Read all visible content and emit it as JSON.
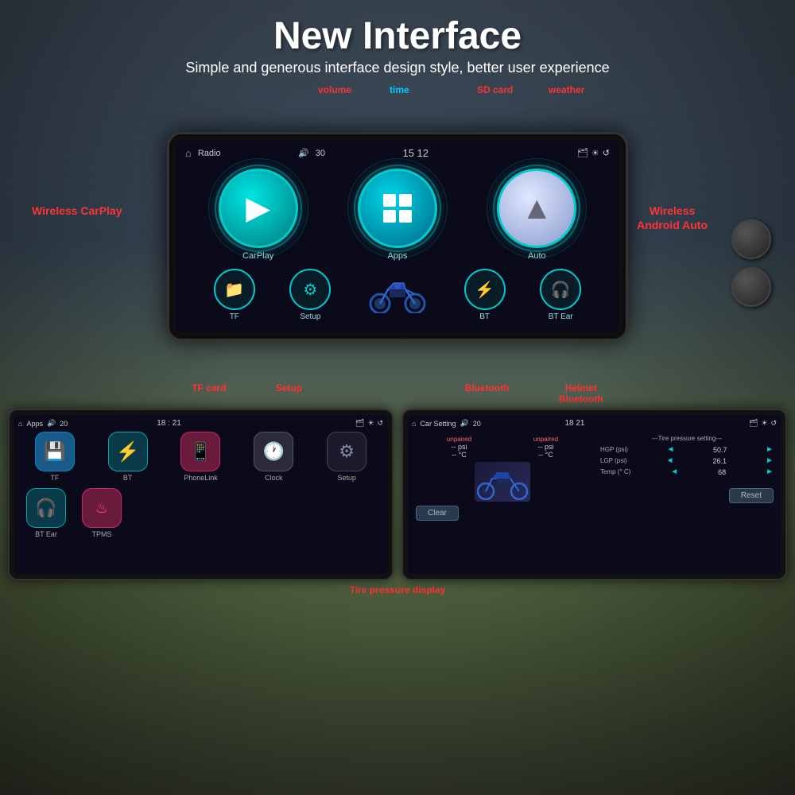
{
  "header": {
    "title": "New Interface",
    "subtitle": "Simple and generous interface design style, better user experience"
  },
  "labels": {
    "volume": "volume",
    "time": "time",
    "sd_card": "SD card",
    "weather": "weather",
    "wireless_carplay": "Wireless\nCarPlay",
    "wireless_android": "Wireless\nAndroid Auto",
    "tf_card": "TF card",
    "setup": "Setup",
    "bluetooth": "Bluetooth",
    "helmet_bluetooth": "Helmet\nBluetooth",
    "tire_pressure_display": "Tire pressure\ndisplay"
  },
  "main_screen": {
    "status": {
      "home_icon": "⌂",
      "radio": "Radio",
      "volume_icon": "🔊",
      "volume": "30",
      "time": "15 12",
      "sd_icon": "📱",
      "brightness_icon": "☀",
      "back_icon": "↺"
    },
    "big_buttons": [
      {
        "label": "CarPlay",
        "icon": "▶"
      },
      {
        "label": "Apps",
        "icon": "grid"
      },
      {
        "label": "Auto",
        "icon": "▲"
      }
    ],
    "small_buttons": [
      {
        "label": "TF",
        "icon": "📁"
      },
      {
        "label": "Setup",
        "icon": "⚙"
      },
      {
        "label": "BT",
        "icon": "⚡"
      },
      {
        "label": "BT Ear",
        "icon": "🎧"
      }
    ]
  },
  "left_mini_screen": {
    "status": {
      "home": "⌂",
      "title": "Apps",
      "volume": "20",
      "time": "18 : 21",
      "sd": "📱",
      "brightness": "☀",
      "back": "↺"
    },
    "row1": [
      {
        "label": "TF",
        "icon": "💾",
        "color": "blue"
      },
      {
        "label": "BT",
        "icon": "⚡",
        "color": "cyan-bg"
      },
      {
        "label": "PhoneLink",
        "icon": "📱",
        "color": "pink"
      },
      {
        "label": "Clock",
        "icon": "🕐",
        "color": "gray"
      },
      {
        "label": "Setup",
        "icon": "⚙",
        "color": "dark"
      }
    ],
    "row2": [
      {
        "label": "BT Ear",
        "icon": "🎧",
        "color": "cyan-bg"
      },
      {
        "label": "TPMS",
        "icon": "♨",
        "color": "pink"
      }
    ]
  },
  "right_mini_screen": {
    "status": {
      "home": "⌂",
      "title": "Car Setting",
      "volume": "20",
      "time": "18 21",
      "sd": "📱",
      "brightness": "☀",
      "back": "↺"
    },
    "tire_left": {
      "status": "unpaired",
      "psi": "-- psi",
      "temp": "-- °C"
    },
    "tire_right": {
      "status": "unpaired",
      "psi": "-- psi",
      "temp": "-- °C"
    },
    "settings_title": "---Tire pressure setting---",
    "settings": [
      {
        "label": "HGP (psi)",
        "value": "50.7"
      },
      {
        "label": "LGP (psi)",
        "value": "26.1"
      },
      {
        "label": "Temp (° C)",
        "value": "68"
      }
    ],
    "clear_btn": "Clear",
    "reset_btn": "Reset"
  }
}
